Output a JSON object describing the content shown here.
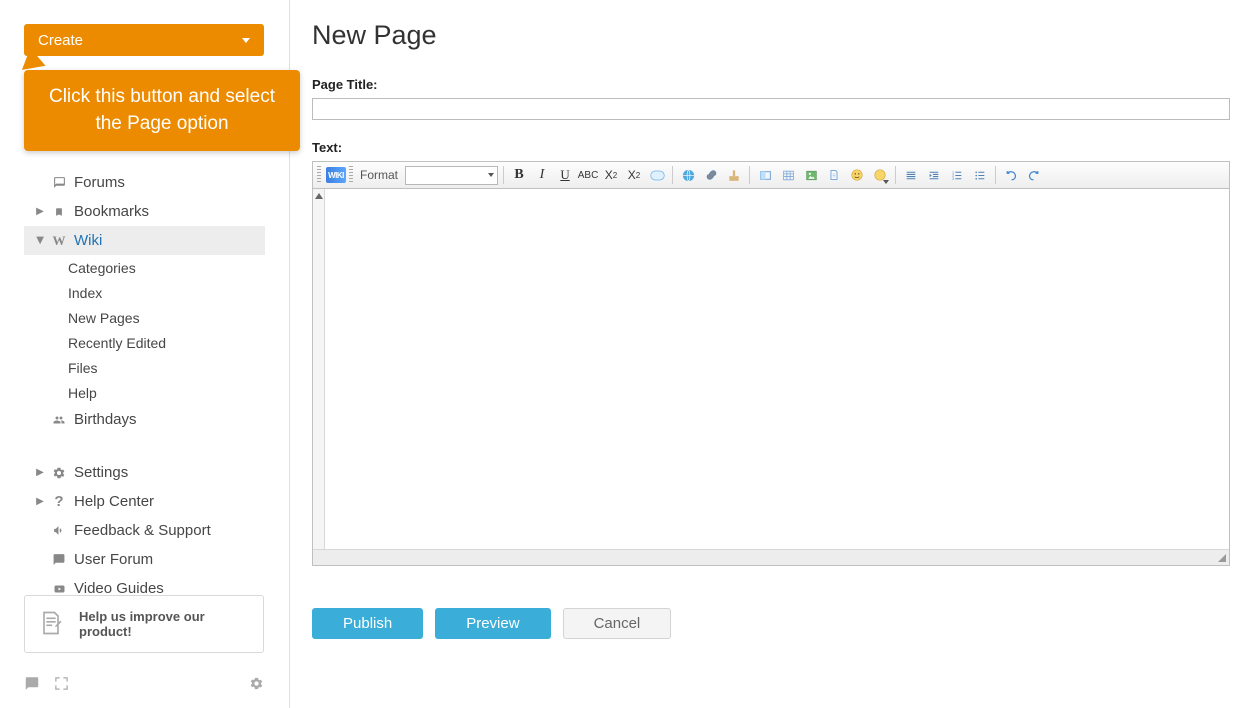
{
  "sidebar": {
    "create_label": "Create",
    "callout_text": "Click this button and select the Page option",
    "nav": [
      {
        "label": "Forums",
        "icon": "comments",
        "has_arrow": false
      },
      {
        "label": "Bookmarks",
        "icon": "bookmark",
        "has_arrow": true
      },
      {
        "label": "Wiki",
        "icon": "w",
        "has_arrow": true,
        "active": true
      }
    ],
    "wiki_sub": [
      "Categories",
      "Index",
      "New Pages",
      "Recently Edited",
      "Files",
      "Help"
    ],
    "birthdays_label": "Birthdays",
    "nav2": [
      {
        "label": "Settings",
        "icon": "gear",
        "has_arrow": true
      },
      {
        "label": "Help Center",
        "icon": "question",
        "has_arrow": true
      },
      {
        "label": "Feedback & Support",
        "icon": "megaphone",
        "has_arrow": false
      },
      {
        "label": "User Forum",
        "icon": "comment-solid",
        "has_arrow": false
      },
      {
        "label": "Video Guides",
        "icon": "youtube",
        "has_arrow": false
      }
    ],
    "improve_label": "Help us improve our product!"
  },
  "main": {
    "heading": "New Page",
    "page_title_label": "Page Title:",
    "text_label": "Text:",
    "toolbar": {
      "wiki_badge": "WIKI",
      "format_label": "Format"
    },
    "buttons": {
      "publish": "Publish",
      "preview": "Preview",
      "cancel": "Cancel"
    }
  }
}
